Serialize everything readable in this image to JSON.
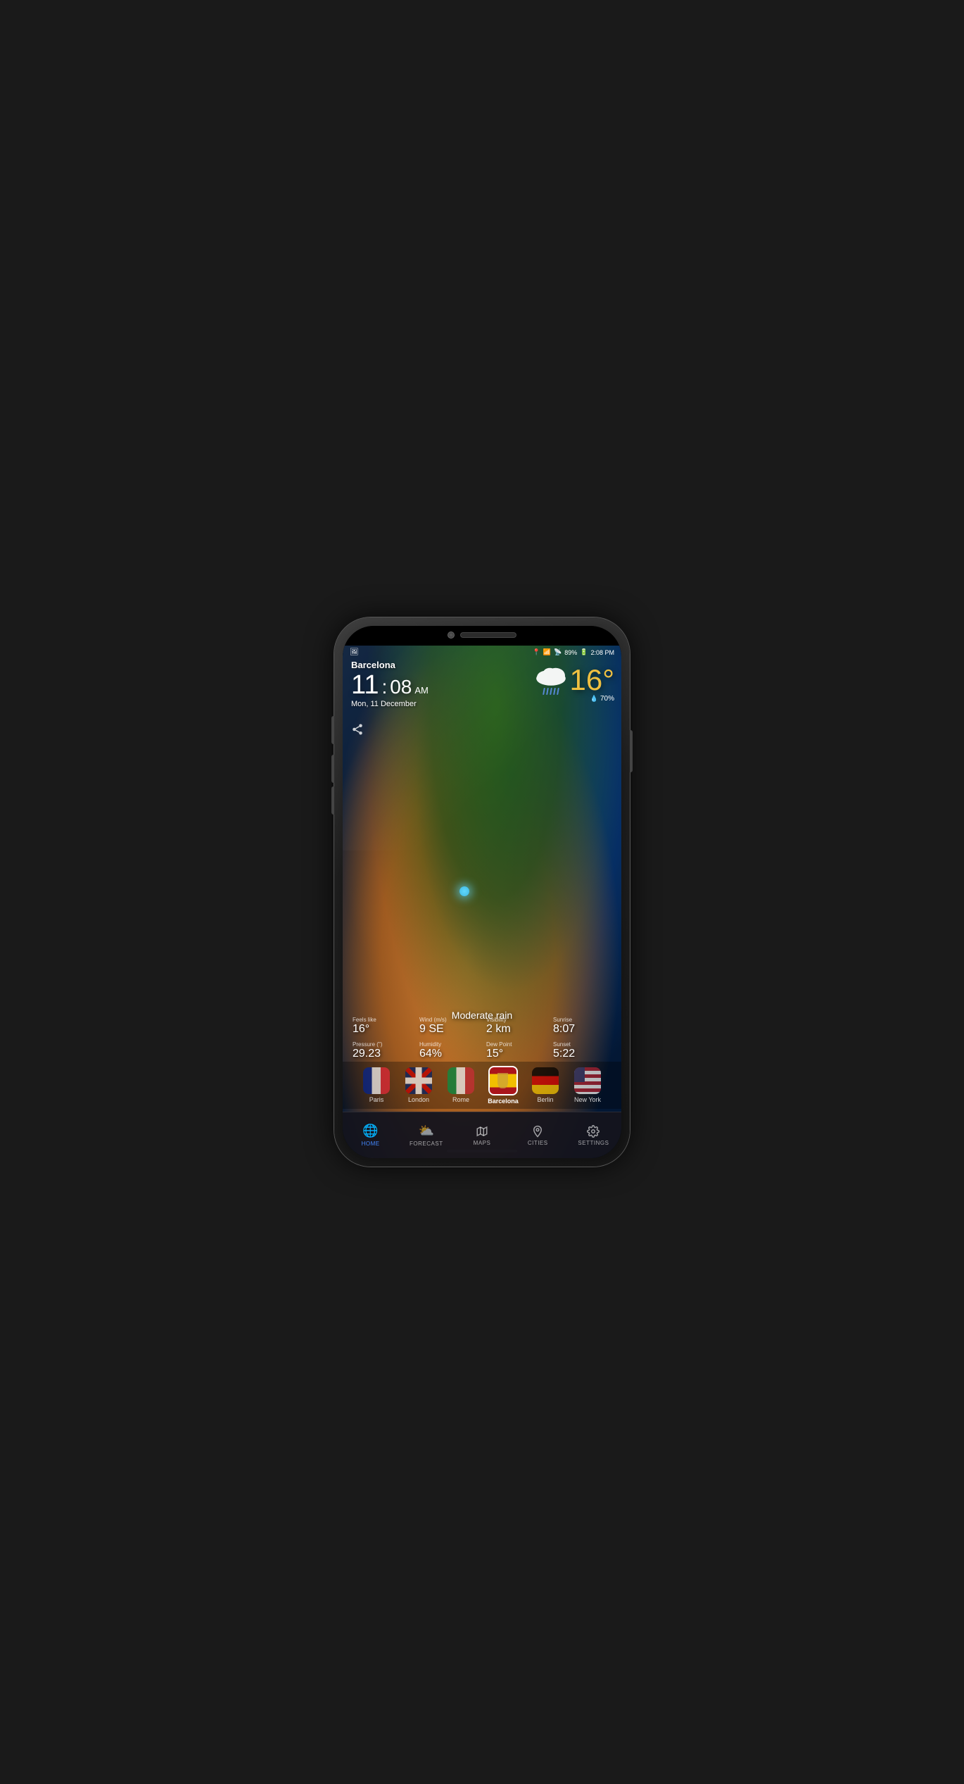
{
  "phone": {
    "camera": "📷"
  },
  "status_bar": {
    "location_icon": "📍",
    "wifi_icon": "wifi",
    "signal_icon": "signal",
    "battery": "89%",
    "battery_charging": "🔋",
    "time": "2:08 PM"
  },
  "weather": {
    "city": "Barcelona",
    "time_hour": "11",
    "time_minute": "08",
    "time_ampm": "AM",
    "date": "Mon, 11 December",
    "temperature": "16°",
    "humidity": "70%",
    "description": "Moderate rain",
    "feels_like_label": "Feels like",
    "feels_like_value": "16°",
    "wind_label": "Wind (m/s)",
    "wind_value": "9 SE",
    "visibility_label": "Visibility",
    "visibility_value": "2 km",
    "sunrise_label": "Sunrise",
    "sunrise_value": "8:07",
    "pressure_label": "Pressure (\")",
    "pressure_value": "29.23",
    "humidity_label": "Humidity",
    "humidity_value": "64%",
    "dewpoint_label": "Dew Point",
    "dewpoint_value": "15°",
    "sunset_label": "Sunset",
    "sunset_value": "5:22"
  },
  "cities": [
    {
      "name": "Paris",
      "selected": false
    },
    {
      "name": "London",
      "selected": false
    },
    {
      "name": "Rome",
      "selected": false
    },
    {
      "name": "Barcelona",
      "selected": true
    },
    {
      "name": "Berlin",
      "selected": false
    },
    {
      "name": "New York",
      "selected": false
    }
  ],
  "nav": {
    "items": [
      {
        "id": "home",
        "label": "HOME",
        "active": true
      },
      {
        "id": "forecast",
        "label": "FORECAST",
        "active": false
      },
      {
        "id": "maps",
        "label": "MAPS",
        "active": false
      },
      {
        "id": "cities",
        "label": "CITIES",
        "active": false
      },
      {
        "id": "settings",
        "label": "SETTINGS",
        "active": false
      }
    ]
  }
}
